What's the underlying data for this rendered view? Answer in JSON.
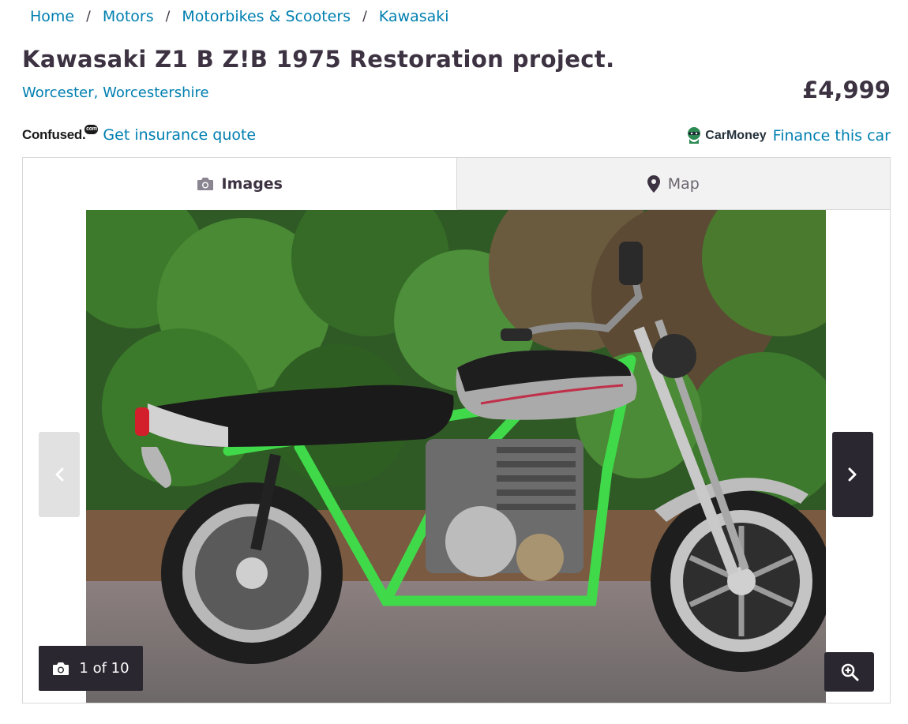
{
  "breadcrumb": {
    "items": [
      "Home",
      "Motors",
      "Motorbikes & Scooters",
      "Kawasaki"
    ],
    "separator": "/"
  },
  "listing": {
    "title": "Kawasaki Z1 B Z!B 1975 Restoration project.",
    "location": "Worcester, Worcestershire",
    "price": "£4,999"
  },
  "insurance": {
    "logo_text": "Confused.",
    "logo_suffix": "com",
    "link_label": "Get insurance quote"
  },
  "finance": {
    "logo_text": "CarMoney",
    "link_label": "Finance this car"
  },
  "gallery": {
    "tabs": [
      {
        "label": "Images",
        "icon": "camera-icon",
        "active": true
      },
      {
        "label": "Map",
        "icon": "map-pin-icon",
        "active": false
      }
    ],
    "counter_text": "1 of 10",
    "current_image": 1,
    "total_images": 10
  },
  "colors": {
    "link": "#007fb0",
    "text": "#3c3241",
    "dark_button": "#2b2730",
    "frame_green": "#3fd94a"
  }
}
